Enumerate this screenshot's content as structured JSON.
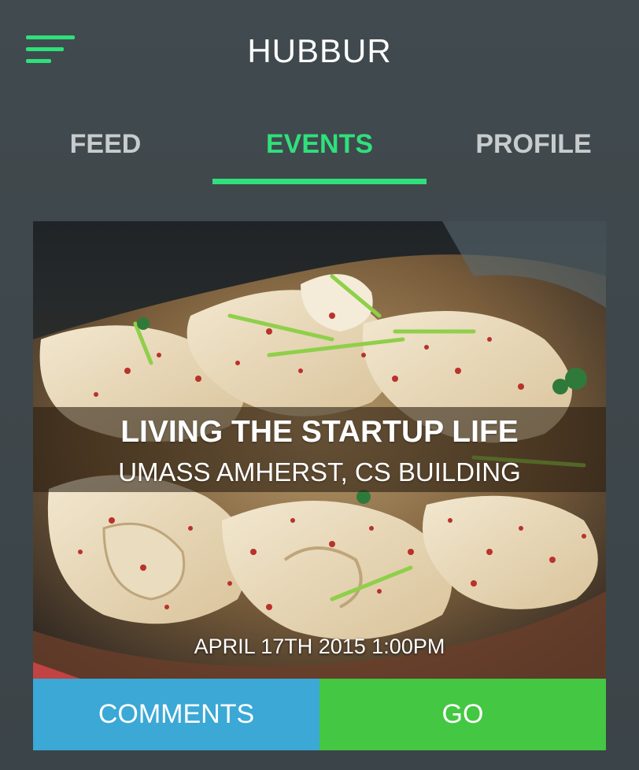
{
  "app": {
    "title": "HUBBUR"
  },
  "tabs": [
    {
      "label": "FEED"
    },
    {
      "label": "EVENTS"
    },
    {
      "label": "PROFILE"
    }
  ],
  "active_tab": "EVENTS",
  "event": {
    "title": "LIVING THE STARTUP LIFE",
    "location": "UMASS AMHERST, CS BUILDING",
    "datetime": "APRIL 17TH 2015 1:00PM",
    "image": "noodle-dish-photo"
  },
  "actions": {
    "comments_label": "COMMENTS",
    "go_label": "GO"
  },
  "colors": {
    "accent": "#2fe07b",
    "comments_button": "#3ba8d6",
    "go_button": "#44c743",
    "background": "#3f484c"
  },
  "icons": {
    "menu": "menu-icon"
  }
}
